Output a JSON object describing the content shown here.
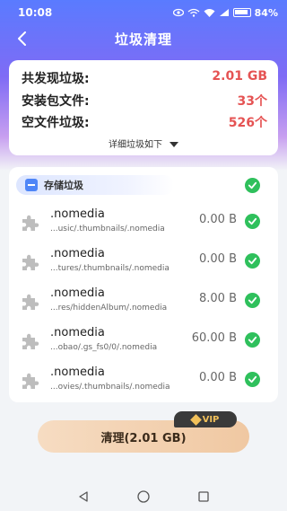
{
  "status_bar": {
    "time": "10:08",
    "battery": "84%"
  },
  "header": {
    "title": "垃圾清理"
  },
  "summary": {
    "rows": [
      {
        "label": "共发现垃圾:",
        "value": "2.01 GB"
      },
      {
        "label": "安装包文件:",
        "value": "33个"
      },
      {
        "label": "空文件垃圾:",
        "value": "526个"
      }
    ],
    "detail_link": "详细垃圾如下"
  },
  "category": {
    "label": "存储垃圾"
  },
  "files": [
    {
      "name": ".nomedia",
      "path": "...usic/.thumbnails/.nomedia",
      "size": "0.00 B"
    },
    {
      "name": ".nomedia",
      "path": "...tures/.thumbnails/.nomedia",
      "size": "0.00 B"
    },
    {
      "name": ".nomedia",
      "path": "...res/hiddenAlbum/.nomedia",
      "size": "8.00 B"
    },
    {
      "name": ".nomedia",
      "path": "...obao/.gs_fs0/0/.nomedia",
      "size": "60.00 B"
    },
    {
      "name": ".nomedia",
      "path": "...ovies/.thumbnails/.nomedia",
      "size": "0.00 B"
    }
  ],
  "clean_button": {
    "label": "清理(2.01 GB)"
  },
  "vip_badge": {
    "label": "VIP"
  },
  "colors": {
    "accent": "#5a7bff",
    "check": "#2fc05c",
    "value_red": "#e55353"
  }
}
